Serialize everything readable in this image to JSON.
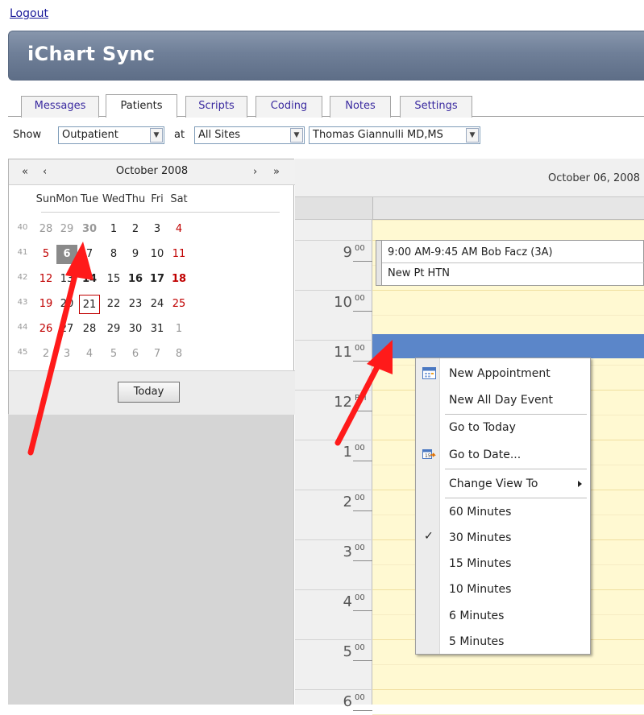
{
  "header": {
    "logout_label": "Logout",
    "app_title": "iChart Sync"
  },
  "tabs": [
    {
      "label": "Messages",
      "active": false
    },
    {
      "label": "Patients",
      "active": true
    },
    {
      "label": "Scripts",
      "active": false
    },
    {
      "label": "Coding",
      "active": false
    },
    {
      "label": "Notes",
      "active": false
    },
    {
      "label": "Settings",
      "active": false
    }
  ],
  "filters": {
    "show_label": "Show",
    "type_value": "Outpatient",
    "at_label": "at",
    "site_value": "All Sites",
    "provider_value": "Thomas Giannulli MD,MS"
  },
  "calendar": {
    "prev_year": "«",
    "prev_month": "‹",
    "month_title": "October 2008",
    "next_month": "›",
    "next_year": "»",
    "day_headers": [
      "Sun",
      "Mon",
      "Tue",
      "Wed",
      "Thu",
      "Fri",
      "Sat"
    ],
    "weeks": [
      {
        "num": "40",
        "days": [
          "28",
          "29",
          "30",
          "1",
          "2",
          "3",
          "4"
        ]
      },
      {
        "num": "41",
        "days": [
          "5",
          "6",
          "7",
          "8",
          "9",
          "10",
          "11"
        ]
      },
      {
        "num": "42",
        "days": [
          "12",
          "13",
          "14",
          "15",
          "16",
          "17",
          "18"
        ]
      },
      {
        "num": "43",
        "days": [
          "19",
          "20",
          "21",
          "22",
          "23",
          "24",
          "25"
        ]
      },
      {
        "num": "44",
        "days": [
          "26",
          "27",
          "28",
          "29",
          "30",
          "31",
          "1"
        ]
      },
      {
        "num": "45",
        "days": [
          "2",
          "3",
          "4",
          "5",
          "6",
          "7",
          "8"
        ]
      }
    ],
    "selected_day": "6",
    "today_day": "21",
    "today_button": "Today"
  },
  "scheduler": {
    "date_header": "October 06, 2008",
    "hours": [
      {
        "hour": "9",
        "mins": "00"
      },
      {
        "hour": "10",
        "mins": "00"
      },
      {
        "hour": "11",
        "mins": "00"
      },
      {
        "hour": "12",
        "mins": "PM"
      },
      {
        "hour": "1",
        "mins": "00"
      },
      {
        "hour": "2",
        "mins": "00"
      },
      {
        "hour": "3",
        "mins": "00"
      },
      {
        "hour": "4",
        "mins": "00"
      },
      {
        "hour": "5",
        "mins": "00"
      },
      {
        "hour": "6",
        "mins": "00"
      }
    ],
    "appointment": {
      "time_text": "9:00 AM-9:45 AM Bob Facz (3A)",
      "description": "New Pt HTN"
    },
    "selected_color": "#5b86c9",
    "day_bg_color": "#fff9d2"
  },
  "context_menu": {
    "items": [
      {
        "label": "New Appointment",
        "icon": "calendar-new-icon"
      },
      {
        "label": "New All Day Event"
      },
      {
        "label": "Go to Today"
      },
      {
        "label": "Go to Date...",
        "icon": "goto-date-icon"
      },
      {
        "label": "Change View To",
        "has_submenu": true
      },
      {
        "label": "60 Minutes"
      },
      {
        "label": "30 Minutes",
        "checked": true
      },
      {
        "label": "15 Minutes"
      },
      {
        "label": "10 Minutes"
      },
      {
        "label": "6 Minutes"
      },
      {
        "label": "5 Minutes"
      }
    ]
  },
  "colors": {
    "banner": "#6f7f98",
    "tab_text": "#3a2aa0",
    "weekend": "#c00000",
    "arrow": "#ff1a1a"
  }
}
